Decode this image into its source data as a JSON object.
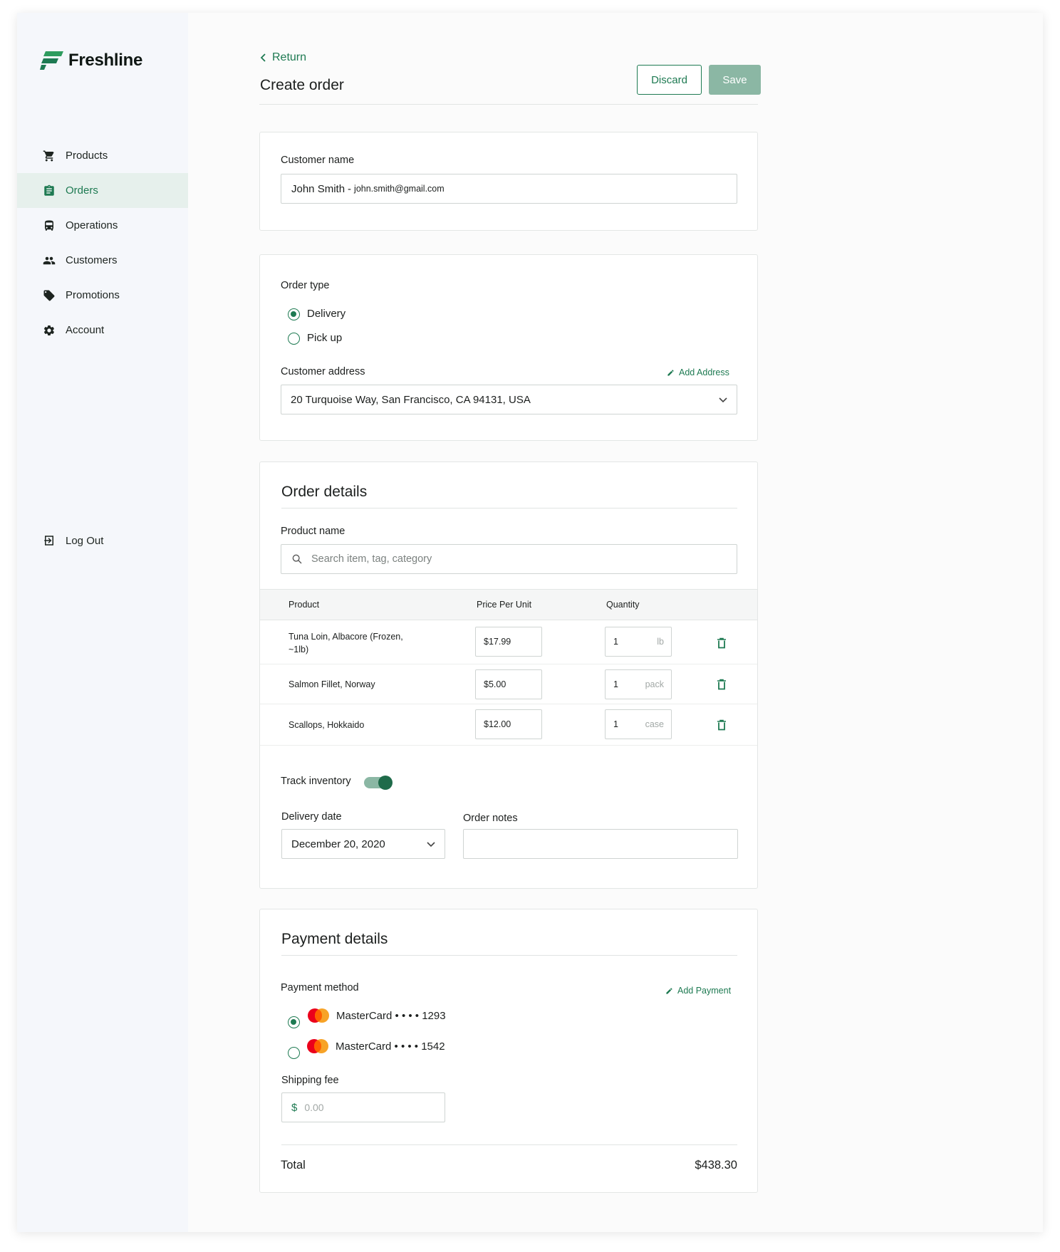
{
  "brand": {
    "name": "Freshline"
  },
  "sidebar": {
    "items": [
      {
        "label": "Products",
        "icon": "cart-icon"
      },
      {
        "label": "Orders",
        "icon": "clipboard-icon"
      },
      {
        "label": "Operations",
        "icon": "bus-icon"
      },
      {
        "label": "Customers",
        "icon": "people-icon"
      },
      {
        "label": "Promotions",
        "icon": "tag-icon"
      },
      {
        "label": "Account",
        "icon": "gear-icon"
      }
    ],
    "active": "Orders",
    "logout": "Log Out"
  },
  "header": {
    "return_label": "Return",
    "title": "Create order",
    "discard_label": "Discard",
    "save_label": "Save"
  },
  "customer": {
    "label": "Customer name",
    "name": "John Smith",
    "separator": "-",
    "email": "john.smith@gmail.com"
  },
  "order_type": {
    "label": "Order type",
    "options": [
      "Delivery",
      "Pick up"
    ],
    "selected": "Delivery",
    "address_label": "Customer address",
    "add_address": "Add Address",
    "address": "20 Turquoise Way, San Francisco, CA 94131, USA"
  },
  "order_details": {
    "title": "Order details",
    "product_label": "Product name",
    "search_placeholder": "Search item, tag, category",
    "columns": [
      "Product",
      "Price Per Unit",
      "Quantity"
    ],
    "rows": [
      {
        "product": "Tuna Loin, Albacore (Frozen, ~1lb)",
        "price": "$17.99",
        "qty": "1",
        "unit": "lb"
      },
      {
        "product": "Salmon Fillet, Norway",
        "price": "$5.00",
        "qty": "1",
        "unit": "pack"
      },
      {
        "product": "Scallops, Hokkaido",
        "price": "$12.00",
        "qty": "1",
        "unit": "case"
      }
    ],
    "track_inventory_label": "Track inventory",
    "track_inventory": true,
    "delivery_date_label": "Delivery date",
    "delivery_date": "December 20, 2020",
    "order_notes_label": "Order notes",
    "order_notes": ""
  },
  "payment": {
    "title": "Payment details",
    "method_label": "Payment method",
    "add_payment": "Add Payment",
    "cards": [
      {
        "label": "MasterCard • • • • 1293",
        "selected": true
      },
      {
        "label": "MasterCard • • • • 1542",
        "selected": false
      }
    ],
    "shipping_label": "Shipping fee",
    "currency_symbol": "$",
    "shipping_placeholder": "0.00",
    "total_label": "Total",
    "total": "$438.30"
  },
  "colors": {
    "accent": "#1e7a52",
    "accent_light": "#8bb7a4",
    "sidebar_bg": "#f5f7fb",
    "active_bg": "#e6f0ec"
  }
}
